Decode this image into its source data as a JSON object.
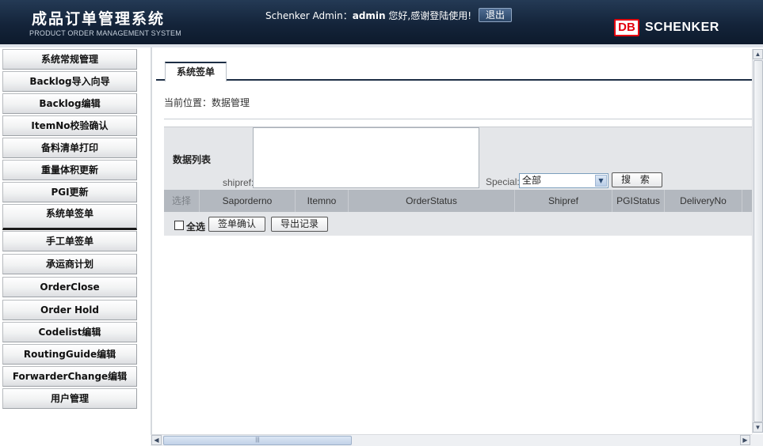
{
  "header": {
    "title_cn": "成品订单管理系统",
    "title_en": "PRODUCT ORDER MANAGEMENT SYSTEM",
    "welcome_prefix": "Schenker Admin：",
    "welcome_user": "admin",
    "welcome_suffix": " 您好,感谢登陆使用!",
    "logout_label": "退出",
    "logo_db": "DB",
    "logo_text": "SCHENKER",
    "brand_color": "#e3000f"
  },
  "sidebar": {
    "items": [
      {
        "label": "系统常规管理"
      },
      {
        "label": "Backlog导入向导"
      },
      {
        "label": "Backlog编辑"
      },
      {
        "label": "ItemNo校验确认"
      },
      {
        "label": "备料清单打印"
      },
      {
        "label": "重量体积更新"
      },
      {
        "label": "PGI更新"
      },
      {
        "label": "系统单签单",
        "active": true
      },
      {
        "label": "手工单签单"
      },
      {
        "label": "承运商计划"
      },
      {
        "label": "OrderClose"
      },
      {
        "label": "Order Hold"
      },
      {
        "label": "Codelist编辑"
      },
      {
        "label": "RoutingGuide编辑"
      },
      {
        "label": "ForwarderChange编辑"
      },
      {
        "label": "用户管理"
      }
    ]
  },
  "main": {
    "tab_label": "系统签单",
    "breadcrumb": "当前位置：数据管理",
    "filter": {
      "list_label": "数据列表",
      "shipref_label": "shipref:",
      "shipref_value": "",
      "special_label": "Special:",
      "special_value": "全部",
      "search_label": "搜 索"
    },
    "table": {
      "columns": [
        "选择",
        "Saporderno",
        "Itemno",
        "OrderStatus",
        "Shipref",
        "PGIStatus",
        "DeliveryNo"
      ],
      "rows": []
    },
    "actions": {
      "select_all_label": "全选",
      "select_all_checked": false,
      "confirm_label": "签单确认",
      "export_label": "导出记录"
    }
  }
}
